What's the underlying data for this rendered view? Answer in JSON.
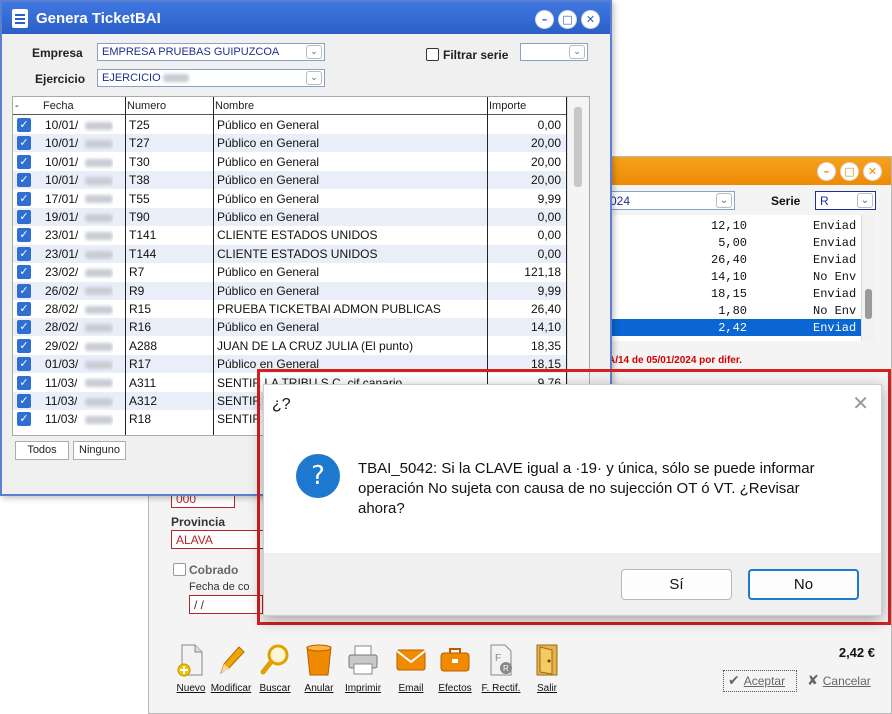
{
  "back_window": {
    "year_value": "024",
    "serie_label": "Serie",
    "serie_value": "R",
    "list_rows": [
      {
        "amount": "12,10",
        "status": "Enviad"
      },
      {
        "amount": "5,00",
        "status": "Enviad"
      },
      {
        "amount": "26,40",
        "status": "Enviad"
      },
      {
        "amount": "14,10",
        "status": "No Env"
      },
      {
        "amount": "18,15",
        "status": "Enviad"
      },
      {
        "amount": "1,80",
        "status": "No Env"
      },
      {
        "amount": "2,42",
        "status": "Enviad"
      }
    ],
    "note": "A/14 de 05/01/2024 por difer.",
    "cp_value": "000",
    "provincia_label": "Provincia",
    "provincia_value": "ALAVA",
    "cobrado_label": "Cobrado",
    "fecha_label": "Fecha de co",
    "fecha_value": " / /",
    "total": "2,42 €",
    "toolbar": [
      {
        "label": "Nuevo",
        "icon": "new-document-icon"
      },
      {
        "label": "Modificar",
        "icon": "pencil-icon"
      },
      {
        "label": "Buscar",
        "icon": "magnifier-icon"
      },
      {
        "label": "Anular",
        "icon": "trash-bin-icon"
      },
      {
        "label": "Imprimir",
        "icon": "printer-icon"
      },
      {
        "label": "Email",
        "icon": "envelope-icon"
      },
      {
        "label": "Efectos",
        "icon": "briefcase-icon"
      },
      {
        "label": "F. Rectif.",
        "icon": "rectify-invoice-icon"
      },
      {
        "label": "Salir",
        "icon": "exit-door-icon"
      }
    ],
    "accept_label": "Aceptar",
    "cancel_label": "Cancelar"
  },
  "window": {
    "title": "Genera TicketBAI",
    "empresa_label": "Empresa",
    "empresa_value": "EMPRESA PRUEBAS GUIPUZCOA",
    "ejercicio_label": "Ejercicio",
    "ejercicio_value": "EJERCICIO",
    "filtrar_label": "Filtrar serie",
    "filtrar_value": ""
  },
  "grid": {
    "columns": [
      "-",
      "Fecha",
      "Numero",
      "Nombre",
      "Importe"
    ],
    "rows": [
      {
        "fecha": "10/01/",
        "numero": "T25",
        "nombre": "Público en General",
        "importe": "0,00"
      },
      {
        "fecha": "10/01/",
        "numero": "T27",
        "nombre": "Público en General",
        "importe": "20,00"
      },
      {
        "fecha": "10/01/",
        "numero": "T30",
        "nombre": "Público en General",
        "importe": "20,00"
      },
      {
        "fecha": "10/01/",
        "numero": "T38",
        "nombre": "Público en General",
        "importe": "20,00"
      },
      {
        "fecha": "17/01/",
        "numero": "T55",
        "nombre": "Público en General",
        "importe": "9,99"
      },
      {
        "fecha": "19/01/",
        "numero": "T90",
        "nombre": "Público en General",
        "importe": "0,00"
      },
      {
        "fecha": "23/01/",
        "numero": "T141",
        "nombre": "CLIENTE ESTADOS UNIDOS",
        "importe": "0,00"
      },
      {
        "fecha": "23/01/",
        "numero": "T144",
        "nombre": "CLIENTE ESTADOS UNIDOS",
        "importe": "0,00"
      },
      {
        "fecha": "23/02/",
        "numero": "R7",
        "nombre": "Público en General",
        "importe": "121,18"
      },
      {
        "fecha": "26/02/",
        "numero": "R9",
        "nombre": "Público en General",
        "importe": "9,99"
      },
      {
        "fecha": "28/02/",
        "numero": "R15",
        "nombre": "PRUEBA TICKETBAI ADMON PUBLICAS",
        "importe": "26,40"
      },
      {
        "fecha": "28/02/",
        "numero": "R16",
        "nombre": "Público en General",
        "importe": "14,10"
      },
      {
        "fecha": "29/02/",
        "numero": "A288",
        "nombre": "JUAN DE LA CRUZ JULIA (El punto)",
        "importe": "18,35"
      },
      {
        "fecha": "01/03/",
        "numero": "R17",
        "nombre": "Público en General",
        "importe": "18,15"
      },
      {
        "fecha": "11/03/",
        "numero": "A311",
        "nombre": "SENTIR LA TRIBU S.C. cif canario",
        "importe": "9,76"
      },
      {
        "fecha": "11/03/",
        "numero": "A312",
        "nombre": "SENTIR",
        "importe": ""
      },
      {
        "fecha": "11/03/",
        "numero": "R18",
        "nombre": "SENTIR",
        "importe": ""
      }
    ],
    "todos_label": "Todos",
    "ninguno_label": "Ninguno"
  },
  "dialog": {
    "title": "¿?",
    "message": "TBAI_5042: Si la CLAVE igual a ·19· y única, sólo se puede informar operación No sujeta con causa de no sujección OT ó VT. ¿Revisar ahora?",
    "yes_label": "Sí",
    "no_label": "No"
  },
  "colors": {
    "back_title_orange": "#ee8a06",
    "window_title_blue": "#2c5fc8",
    "checkbox_blue": "#2f6fd2",
    "highlight_frame_red": "#d42020",
    "dialog_icon_blue": "#1d79cf"
  }
}
